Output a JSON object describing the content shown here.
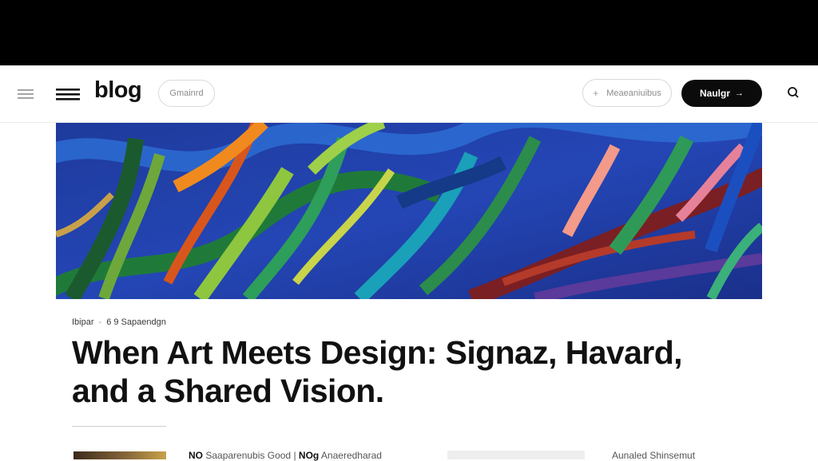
{
  "header": {
    "logo": "blog",
    "category_pill": "Gmainrd",
    "newsletter_pill": "Meaeaniuibus",
    "newsletter_plus": "+",
    "cta_label": "Naulgr",
    "cta_arrow": "→"
  },
  "icons": {
    "sidebar_toggle": "hamburger-icon",
    "menu": "menu-icon",
    "search": "search-icon"
  },
  "article": {
    "meta_author": "Ibipar",
    "meta_sep": "-",
    "meta_read": "6 9 Sapaendgn",
    "title_line1": "When Art Meets Design:  Signaz, Havard,",
    "title_line2": "and a Shared Vision.",
    "byline_prefix": "NO",
    "byline_text": "Saaparenubis Good",
    "byline_sep": "|",
    "byline_prefix2": "NOg",
    "byline_text2": "Anaeredharad",
    "related_label": "Aunaled Shinsemut"
  },
  "colors": {
    "topbar": "#000000",
    "cta_bg": "#0b0b0b",
    "hero_base": "#1f3fa8"
  }
}
